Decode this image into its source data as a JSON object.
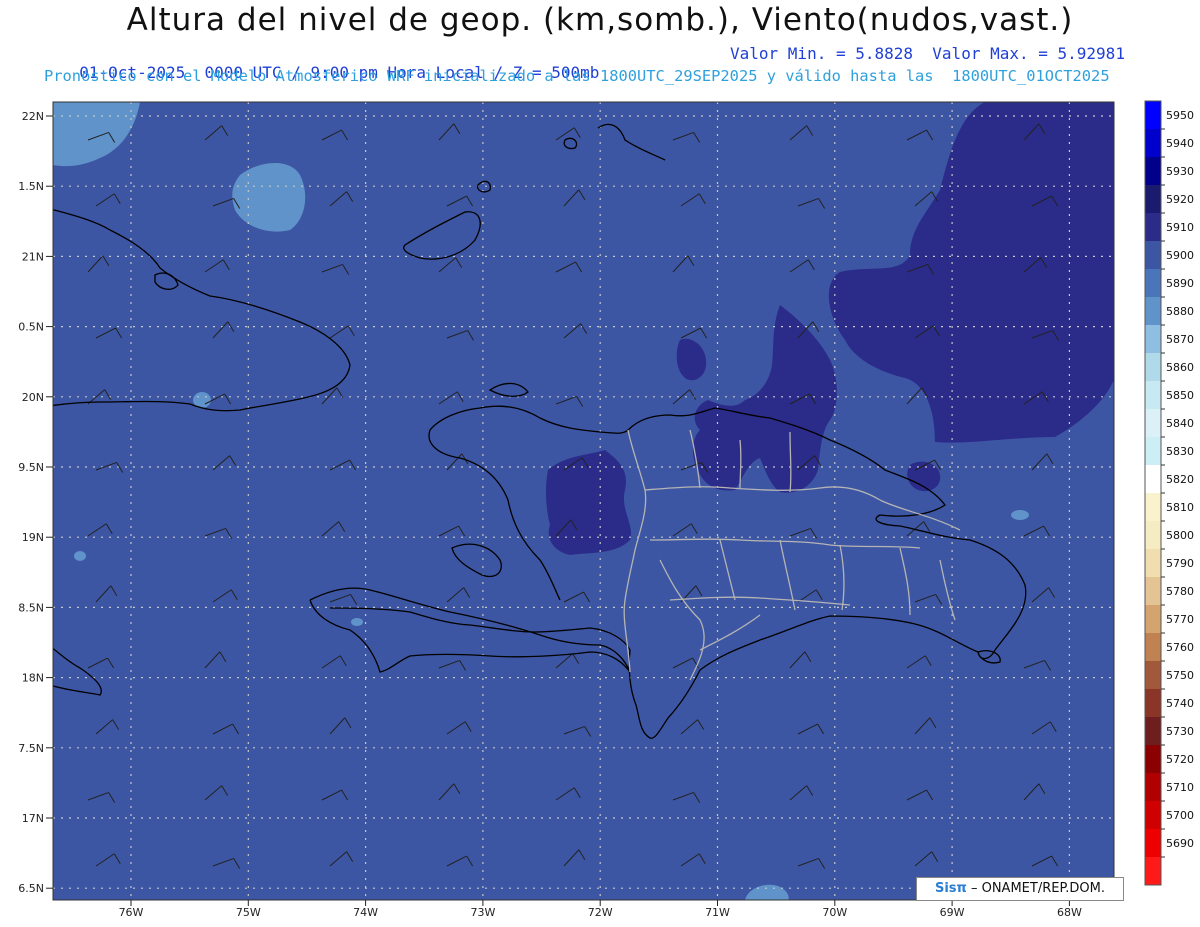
{
  "title": "Altura del nivel de geop. (km,somb.), Viento(nudos,vast.)",
  "subtitle_left": "01-Oct-2025  0000 UTC / 9:00 pm Hora Local / Z = 500mb",
  "subtitle_right": "Valor Min. = 5.8828  Valor Max. = 5.92981",
  "subtitle2": "Pronóstico con el Modelo Atmosferico WRF inicializado a las 1800UTC_29SEP2025 y válido hasta las  1800UTC_01OCT2025",
  "credit": {
    "brand": "Sisπ",
    "text": "– ONAMET/REP.DOM."
  },
  "axes": {
    "lat_labels": [
      "22N",
      "1.5N",
      "21N",
      "0.5N",
      "20N",
      "9.5N",
      "19N",
      "8.5N",
      "18N",
      "7.5N",
      "17N",
      "6.5N"
    ],
    "lon_labels": [
      "76W",
      "75W",
      "74W",
      "73W",
      "72W",
      "71W",
      "70W",
      "69W",
      "68W"
    ]
  },
  "colorbar": {
    "labels": [
      "5950",
      "5940",
      "5930",
      "5920",
      "5910",
      "5900",
      "5890",
      "5880",
      "5870",
      "5860",
      "5850",
      "5840",
      "5830",
      "5820",
      "5810",
      "5800",
      "5790",
      "5780",
      "5770",
      "5760",
      "5750",
      "5740",
      "5730",
      "5720",
      "5710",
      "5700",
      "5690"
    ],
    "colors": [
      "#0000ff",
      "#0000cc",
      "#00008b",
      "#1a1a6e",
      "#2b2b8a",
      "#3d56a3",
      "#4a75b8",
      "#5f93c9",
      "#8fbfe0",
      "#b0daea",
      "#c9e9f2",
      "#dbf1f7",
      "#cdeef5",
      "#ffffff",
      "#faf2cc",
      "#f6ecc4",
      "#f0ddb0",
      "#e4c494",
      "#d3a470",
      "#c08252",
      "#a2583a",
      "#8b3528",
      "#6e1e1e",
      "#8b0000",
      "#b00000",
      "#d00000",
      "#ee0000",
      "#ff1a1a"
    ]
  },
  "colors": {
    "ocean_base": "#3d56a3",
    "high": "#2b2b8a",
    "low": "#5f93c9",
    "coast": "#000000",
    "borders": "#b4b4b4"
  }
}
